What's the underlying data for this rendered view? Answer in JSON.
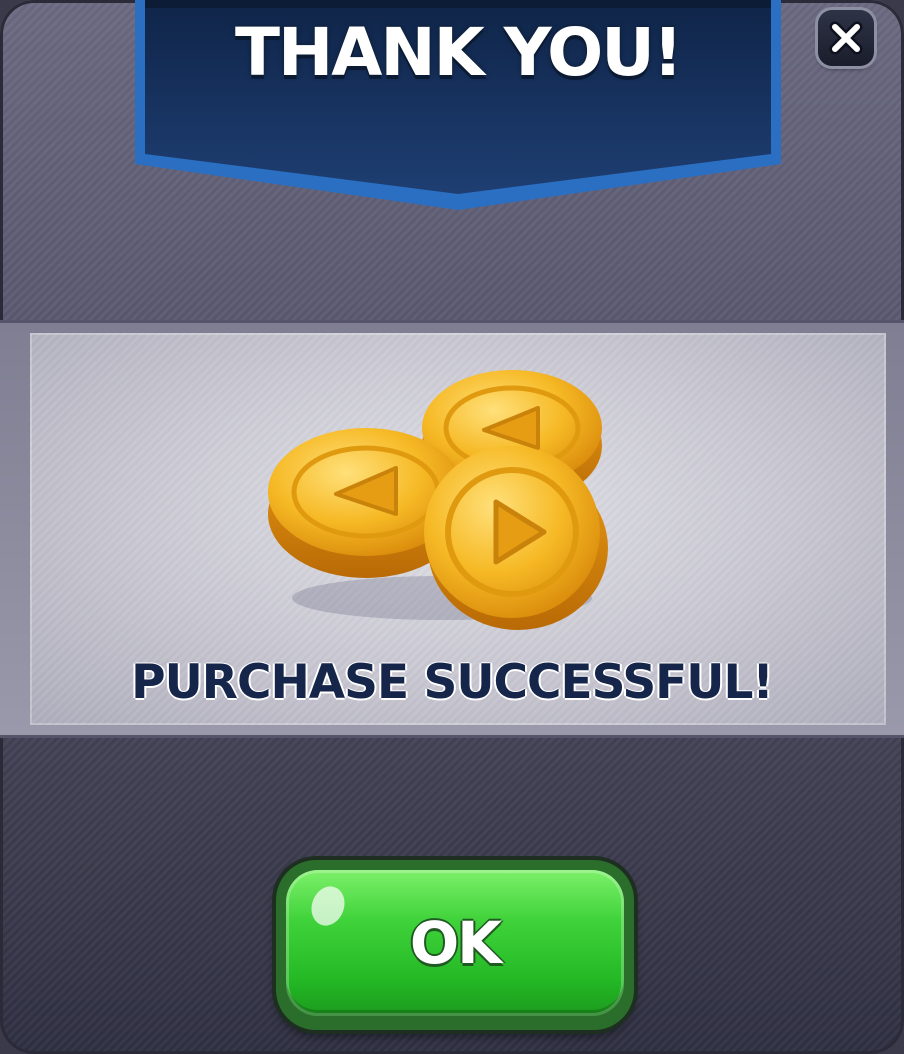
{
  "dialog": {
    "title": "THANK YOU!",
    "message": "PURCHASE SUCCESSFUL!",
    "reward_icon": "coin-stack-icon",
    "close_icon": "close-icon",
    "ok_label": "OK"
  },
  "colors": {
    "banner": "#17335f",
    "banner_border": "#2b72c4",
    "message_text": "#16264a",
    "ok_button": "#3fd23a",
    "coin": "#f2b21e"
  }
}
